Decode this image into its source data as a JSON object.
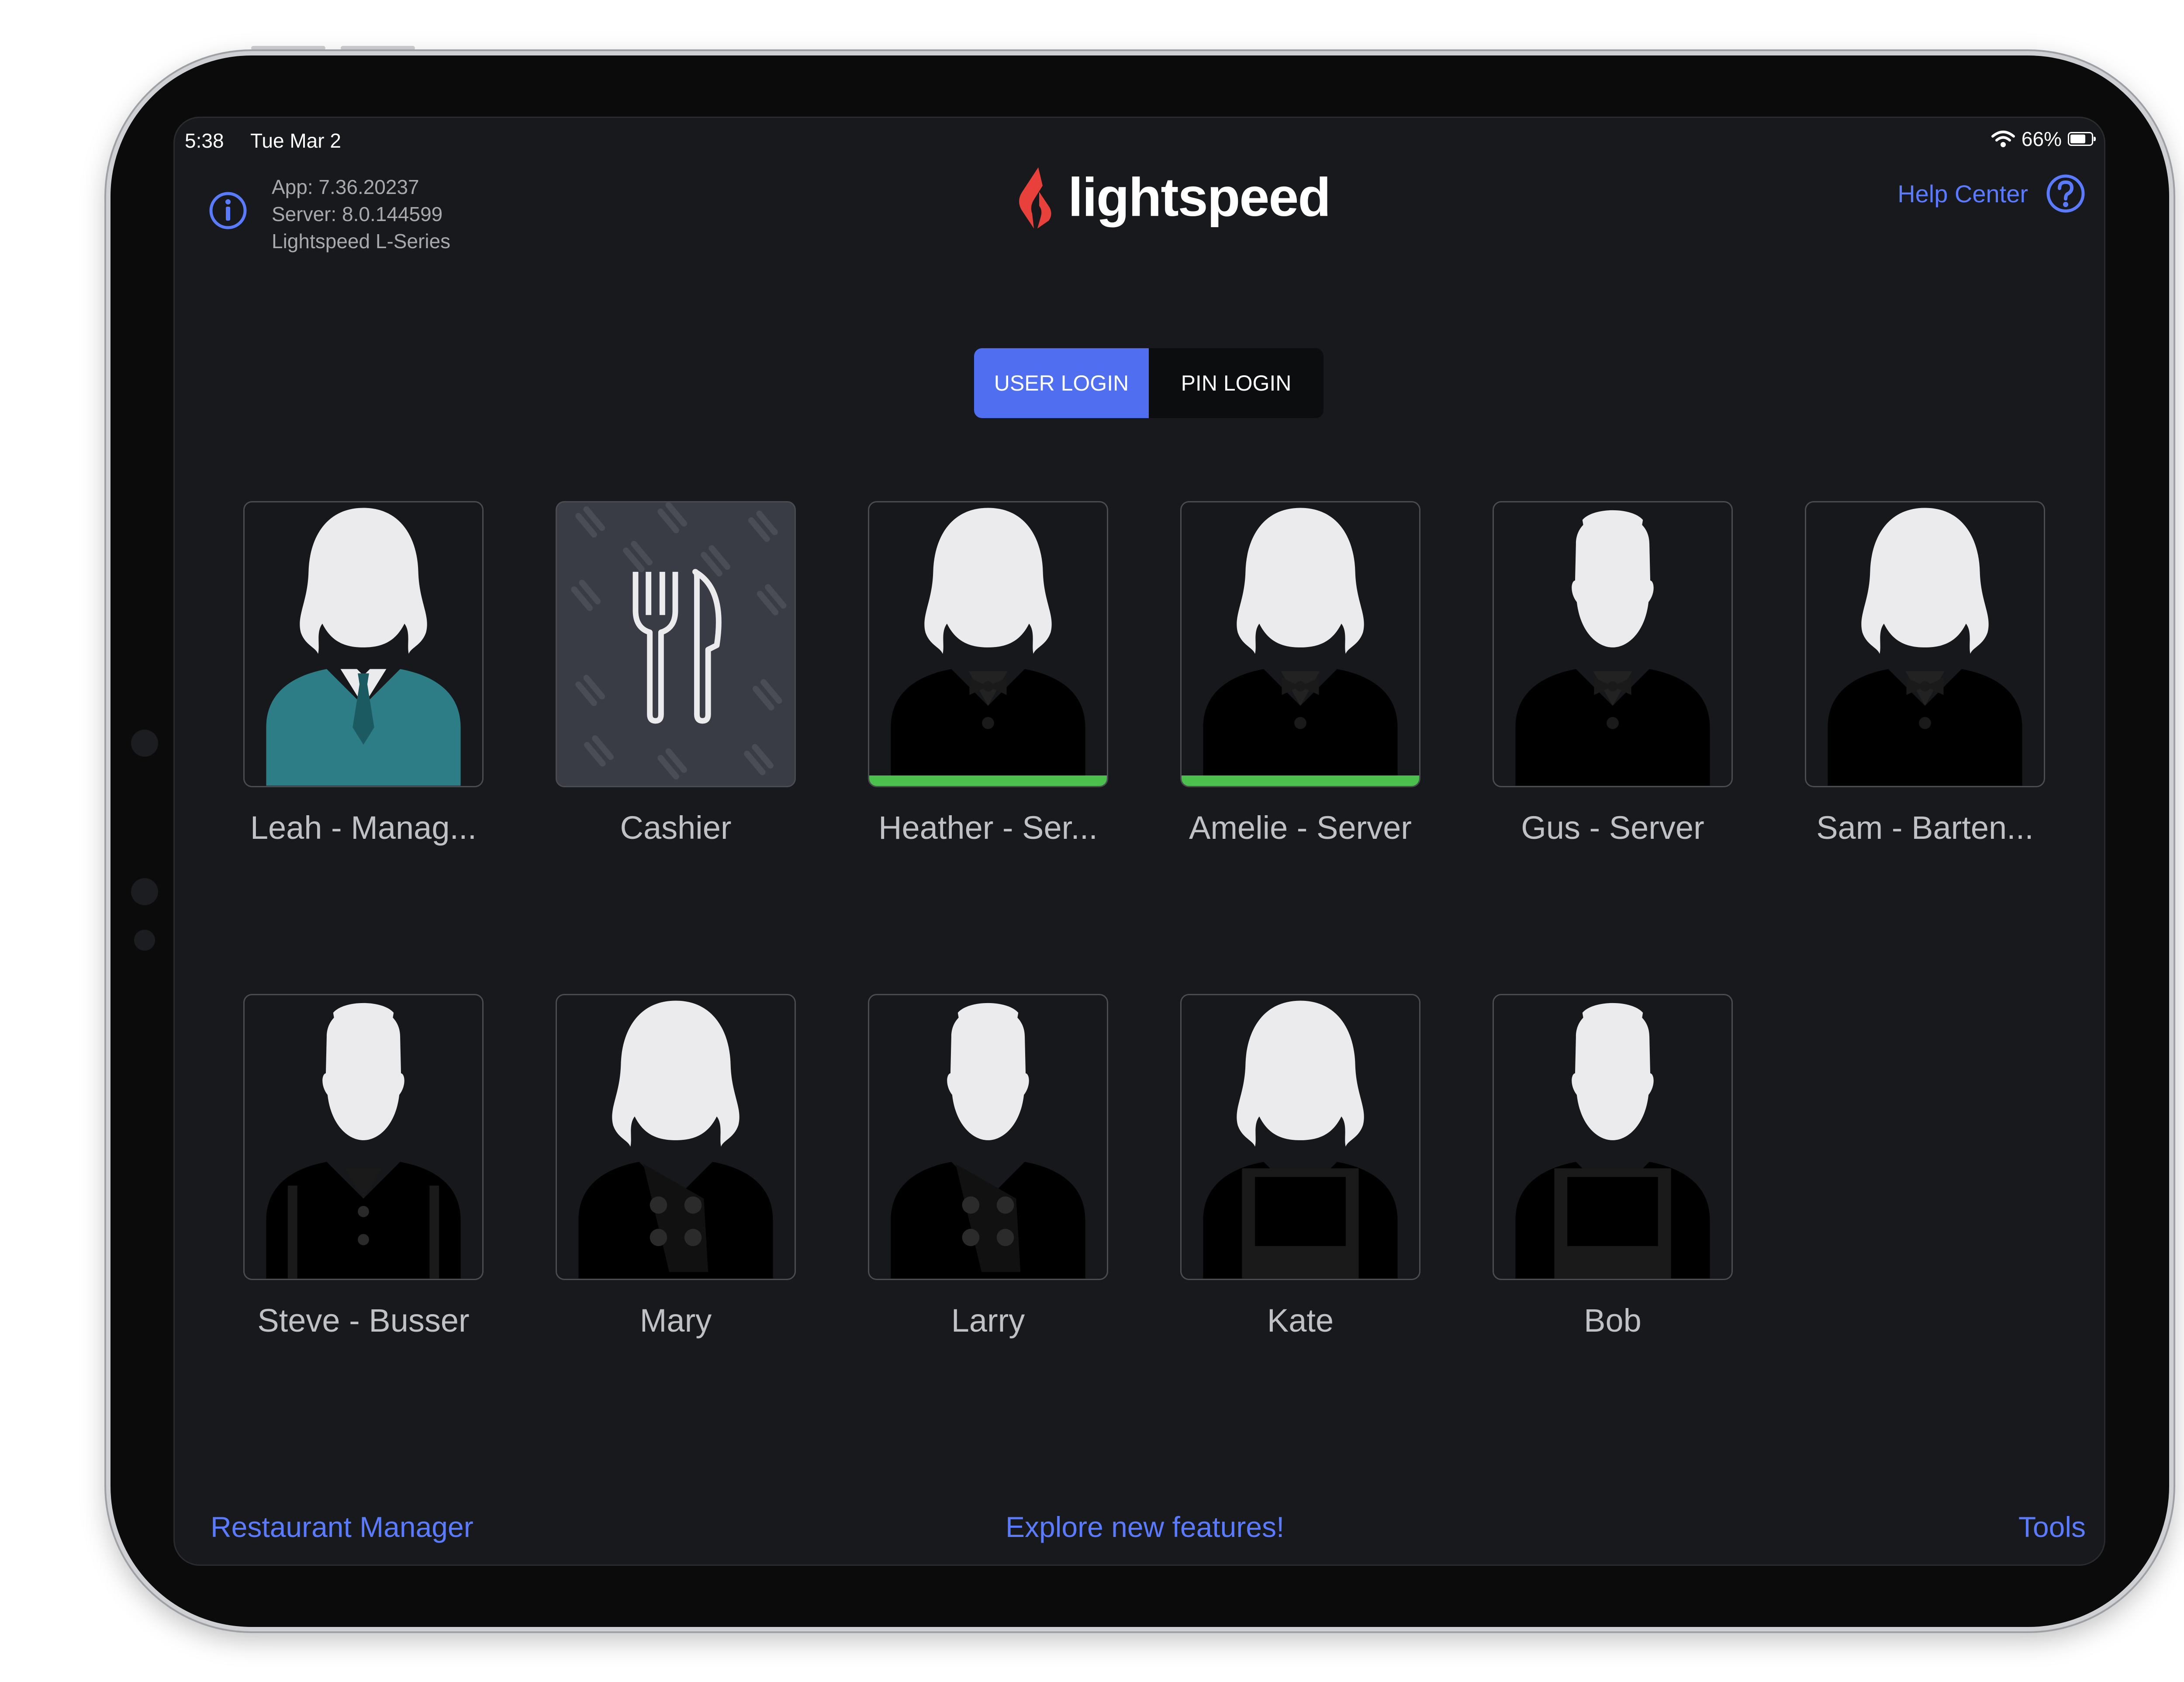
{
  "status_bar": {
    "time": "5:38",
    "date": "Tue Mar 2",
    "battery": "66%",
    "battery_level": 0.66
  },
  "header": {
    "app_version": "App: 7.36.20237",
    "server_version": "Server: 8.0.144599",
    "product": "Lightspeed L-Series",
    "brand": "lightspeed",
    "help_label": "Help Center"
  },
  "login_toggle": {
    "user_login": "USER LOGIN",
    "pin_login": "PIN LOGIN",
    "selected": "USER LOGIN"
  },
  "users": [
    {
      "name": "Leah - Manag...",
      "avatar": "woman-manager-avatar",
      "active": false
    },
    {
      "name": "Cashier",
      "avatar": "cutlery-icon",
      "active": false
    },
    {
      "name": "Heather - Ser...",
      "avatar": "woman-server-avatar",
      "active": true
    },
    {
      "name": "Amelie - Server",
      "avatar": "woman-server-avatar",
      "active": true
    },
    {
      "name": "Gus - Server",
      "avatar": "man-server-avatar",
      "active": false
    },
    {
      "name": "Sam - Barten...",
      "avatar": "woman-server-avatar",
      "active": false
    },
    {
      "name": "Steve - Busser",
      "avatar": "man-busser-avatar",
      "active": false
    },
    {
      "name": "Mary",
      "avatar": "woman-chef-avatar",
      "active": false
    },
    {
      "name": "Larry",
      "avatar": "man-chef-avatar",
      "active": false
    },
    {
      "name": "Kate",
      "avatar": "woman-apron-avatar",
      "active": false
    },
    {
      "name": "Bob",
      "avatar": "man-apron-avatar",
      "active": false
    }
  ],
  "footer": {
    "restaurant_manager": "Restaurant Manager",
    "explore": "Explore new features!",
    "tools": "Tools"
  },
  "colors": {
    "accent": "#4f6ff0",
    "link": "#5b7bff",
    "active_bar": "#4cc04c",
    "manager_suit": "#2c7d86",
    "brand_red": "#e8413c"
  }
}
